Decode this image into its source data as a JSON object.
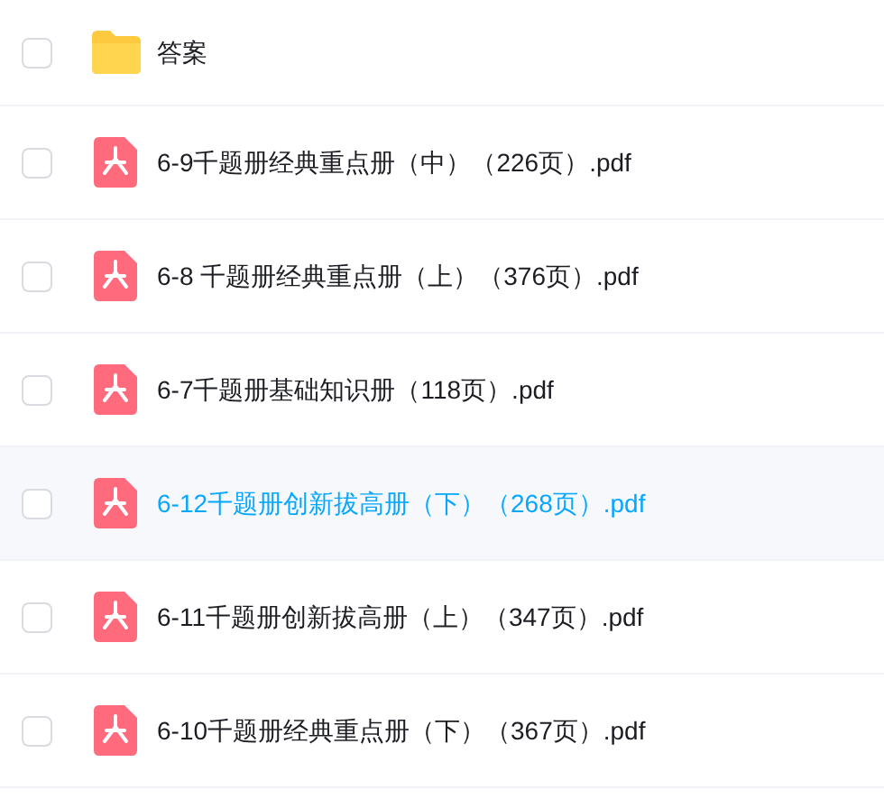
{
  "files": [
    {
      "kind": "folder",
      "name": "答案",
      "checked": false,
      "highlighted": false
    },
    {
      "kind": "pdf",
      "name": "6-9千题册经典重点册（中）（226页）.pdf",
      "checked": false,
      "highlighted": false
    },
    {
      "kind": "pdf",
      "name": "6-8 千题册经典重点册（上）（376页）.pdf",
      "checked": false,
      "highlighted": false
    },
    {
      "kind": "pdf",
      "name": "6-7千题册基础知识册（118页）.pdf",
      "checked": false,
      "highlighted": false
    },
    {
      "kind": "pdf",
      "name": "6-12千题册创新拔高册（下）（268页）.pdf",
      "checked": false,
      "highlighted": true
    },
    {
      "kind": "pdf",
      "name": "6-11千题册创新拔高册（上）（347页）.pdf",
      "checked": false,
      "highlighted": false
    },
    {
      "kind": "pdf",
      "name": "6-10千题册经典重点册（下）（367页）.pdf",
      "checked": false,
      "highlighted": false
    }
  ]
}
